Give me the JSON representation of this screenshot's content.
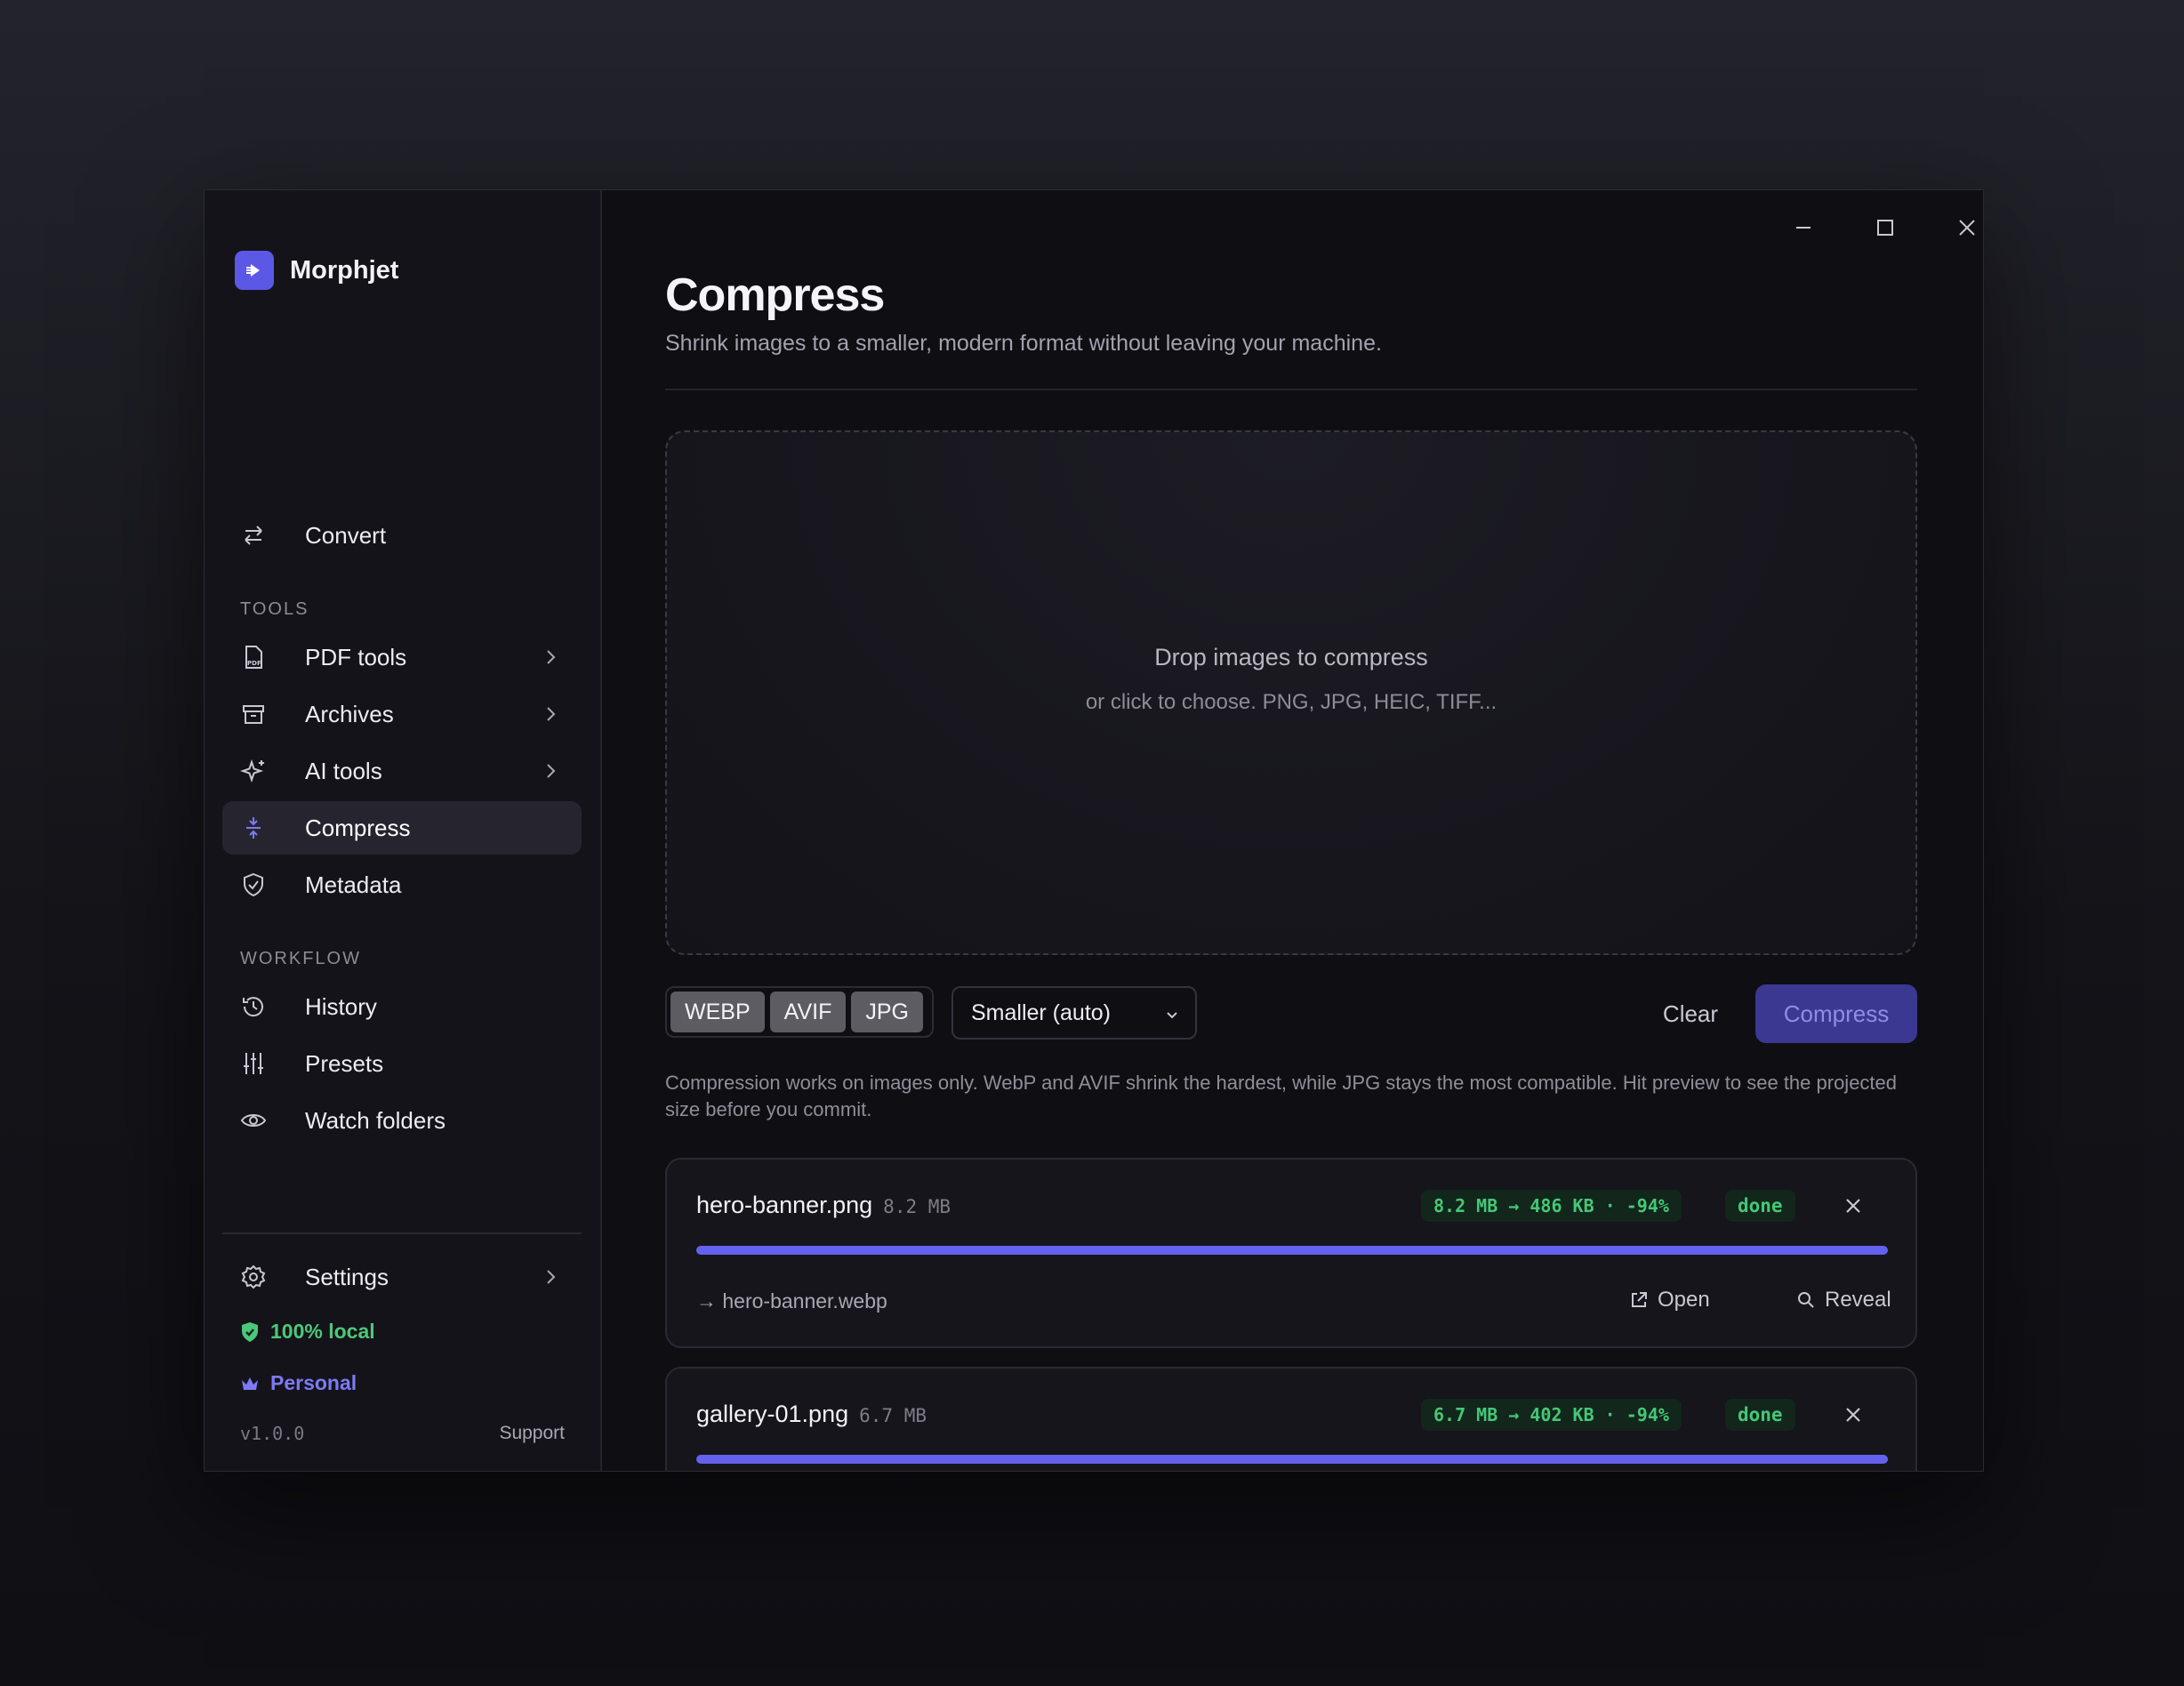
{
  "app": {
    "name": "Morphjet"
  },
  "sidebar": {
    "convert": "Convert",
    "tools_header": "TOOLS",
    "tools": [
      {
        "label": "PDF tools",
        "icon": "pdf-icon"
      },
      {
        "label": "Archives",
        "icon": "archive-icon"
      },
      {
        "label": "AI tools",
        "icon": "sparkles-icon"
      },
      {
        "label": "Compress",
        "icon": "compress-icon",
        "active": true
      },
      {
        "label": "Metadata",
        "icon": "shield-icon"
      }
    ],
    "workflow_header": "WORKFLOW",
    "workflow": [
      {
        "label": "History",
        "icon": "history-icon"
      },
      {
        "label": "Presets",
        "icon": "sliders-icon"
      },
      {
        "label": "Watch folders",
        "icon": "eye-icon"
      }
    ],
    "settings": "Settings",
    "local_badge": "100% local",
    "plan": "Personal",
    "version": "v1.0.0",
    "support": "Support"
  },
  "main": {
    "title": "Compress",
    "subtitle": "Shrink images to a smaller, modern format without leaving your machine.",
    "drop_title": "Drop images to compress",
    "drop_sub": "or click to choose. PNG, JPG, HEIC, TIFF...",
    "formats": [
      "WEBP",
      "AVIF",
      "JPG"
    ],
    "quality": "Smaller (auto)",
    "clear": "Clear",
    "compress": "Compress",
    "info": "Compression works on images only. WebP and AVIF shrink the hardest, while JPG stays the most compatible. Hit preview to see the projected size before you commit."
  },
  "files": [
    {
      "name": "hero-banner.png",
      "size": "8.2 MB",
      "stat": "8.2 MB → 486 KB · -94%",
      "status": "done",
      "progress": 1.0,
      "output": "→ hero-banner.webp",
      "open": "Open",
      "reveal": "Reveal"
    },
    {
      "name": "gallery-01.png",
      "size": "6.7 MB",
      "stat": "6.7 MB → 402 KB · -94%",
      "status": "done",
      "progress": 1.0
    }
  ],
  "colors": {
    "accent": "#5b58e6",
    "success": "#45c777",
    "plan": "#7c7af5"
  }
}
